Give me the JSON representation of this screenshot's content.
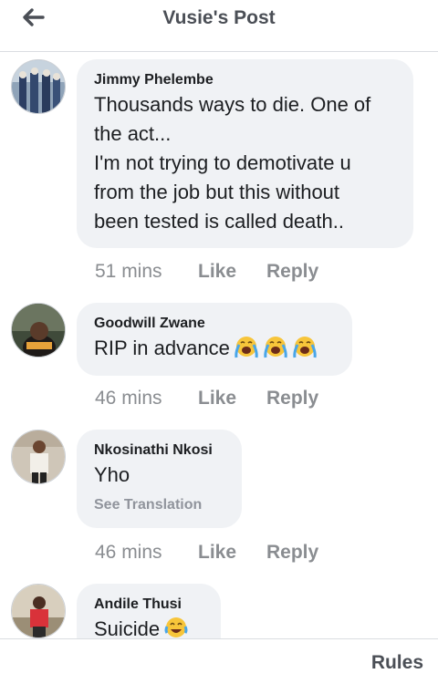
{
  "header": {
    "title": "Vusie's Post",
    "back_icon": "arrow-left-icon"
  },
  "comments": [
    {
      "author": "Jimmy Phelembe",
      "lines": [
        "Thousands ways to die. One of",
        "the act...",
        "I'm not trying to demotivate u",
        "from the job but this without",
        "been tested is called death.."
      ],
      "time": "51 mins",
      "like": "Like",
      "reply": "Reply"
    },
    {
      "author": "Goodwill Zwane",
      "lines": [
        "RIP in advance"
      ],
      "emojis": [
        "loudly-crying-face-icon",
        "loudly-crying-face-icon",
        "loudly-crying-face-icon"
      ],
      "time": "46 mins",
      "like": "Like",
      "reply": "Reply"
    },
    {
      "author": "Nkosinathi Nkosi",
      "lines": [
        "Yho"
      ],
      "see_translation": "See Translation",
      "time": "46 mins",
      "like": "Like",
      "reply": "Reply"
    },
    {
      "author": "Andile Thusi",
      "lines": [
        "Suicide"
      ],
      "emojis": [
        "tears-of-joy-face-icon"
      ]
    }
  ],
  "footer": {
    "rules": "Rules"
  },
  "colors": {
    "bubble": "#f0f2f5",
    "meta": "#8a8d91",
    "divider": "#dadde1"
  }
}
